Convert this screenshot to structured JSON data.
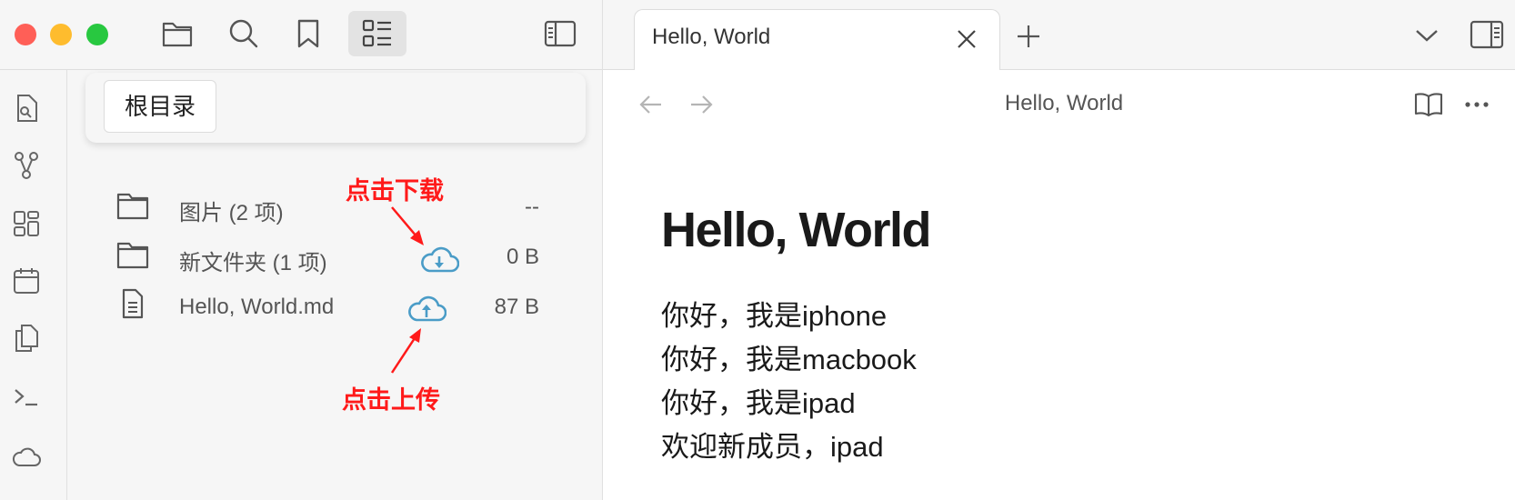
{
  "window": {
    "traffic_lights": {
      "close": "#ff5f57",
      "minimize": "#febc2e",
      "zoom": "#28c840"
    }
  },
  "left_toolbar": {
    "icons": [
      "folder-icon",
      "search-icon",
      "bookmark-icon",
      "list-icon",
      "sidebar-toggle-icon"
    ],
    "active": "list-icon"
  },
  "ribbon": {
    "icons": [
      "file-search-icon",
      "graph-icon",
      "grid-icon",
      "calendar-icon",
      "copy-icon",
      "terminal-icon",
      "cloud-icon"
    ]
  },
  "breadcrumb": {
    "root_label": "根目录"
  },
  "file_list": [
    {
      "name": "图片 (2 项)",
      "type": "folder",
      "size": "--",
      "sync_icon": ""
    },
    {
      "name": "新文件夹 (1 项)",
      "type": "folder",
      "size": "0 B",
      "sync_icon": "cloud-download-icon"
    },
    {
      "name": "Hello, World.md",
      "type": "file",
      "size": "87 B",
      "sync_icon": "cloud-upload-icon"
    }
  ],
  "annotations": {
    "download": "点击下载",
    "upload": "点击上传",
    "color": "#ff1a1a"
  },
  "tab": {
    "label": "Hello, World"
  },
  "document": {
    "header_title": "Hello, World",
    "heading": "Hello, World",
    "lines": [
      "你好，我是iphone",
      "你好，我是macbook",
      "你好，我是ipad",
      "欢迎新成员，ipad"
    ]
  },
  "colors": {
    "cloud_icon": "#4a9cc7"
  }
}
